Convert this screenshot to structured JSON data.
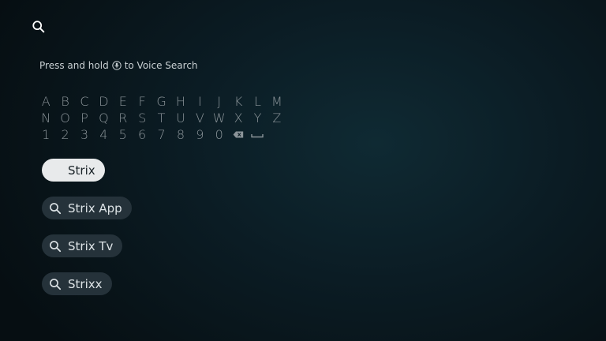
{
  "header": {
    "search_icon": "search-icon"
  },
  "hint": {
    "before": "Press and hold",
    "after": "to Voice Search",
    "icon": "voice-button-icon"
  },
  "keyboard": {
    "row1": [
      "A",
      "B",
      "C",
      "D",
      "E",
      "F",
      "G",
      "H",
      "I",
      "J",
      "K",
      "L",
      "M"
    ],
    "row2": [
      "N",
      "O",
      "P",
      "Q",
      "R",
      "S",
      "T",
      "U",
      "V",
      "W",
      "X",
      "Y",
      "Z"
    ],
    "row3": [
      "1",
      "2",
      "3",
      "4",
      "5",
      "6",
      "7",
      "8",
      "9",
      "0"
    ],
    "special_keys": [
      "backspace-icon",
      "space-icon"
    ]
  },
  "suggestions": [
    {
      "label": "Strix",
      "selected": true
    },
    {
      "label": "Strix App",
      "selected": false
    },
    {
      "label": "Strix Tv",
      "selected": false
    },
    {
      "label": "Strixx",
      "selected": false
    }
  ],
  "colors": {
    "key_text": "#8b9499",
    "pill_bg": "#25323a",
    "pill_selected_bg": "#e8eaeb"
  }
}
